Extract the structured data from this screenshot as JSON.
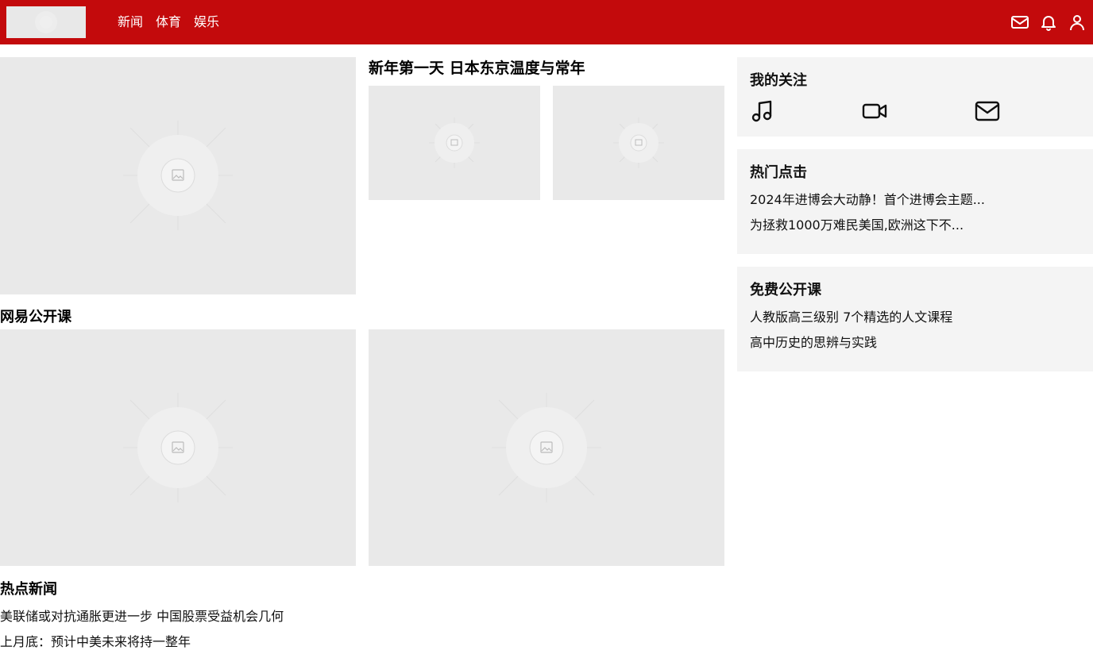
{
  "header": {
    "logo": "logo",
    "nav": [
      {
        "label": "新闻"
      },
      {
        "label": "体育"
      },
      {
        "label": "娱乐"
      }
    ],
    "icons": [
      "mail-icon",
      "bell-icon",
      "user-icon"
    ],
    "background_color": "#c30a0c"
  },
  "main": {
    "feature_title": "新年第一天 日本东京温度与常年",
    "open_course_title": "网易公开课",
    "hot_news_title": "热点新闻",
    "hot_news": [
      "美联储或对抗通胀更进一步 中国股票受益机会几何",
      "上月底：预计中美未来将持一整年"
    ]
  },
  "sidebar": {
    "follow": {
      "title": "我的关注",
      "icons": [
        "music-icon",
        "video-icon",
        "mail-icon"
      ]
    },
    "hot_clicks": {
      "title": "热门点击",
      "items": [
        "2024年进博会大动静！首个进博会主题...",
        "为拯救1000万难民美国,欧洲这下不..."
      ]
    },
    "free_courses": {
      "title": "免费公开课",
      "items": [
        "人教版高三级别 7个精选的人文课程",
        "高中历史的思辨与实践"
      ]
    }
  }
}
